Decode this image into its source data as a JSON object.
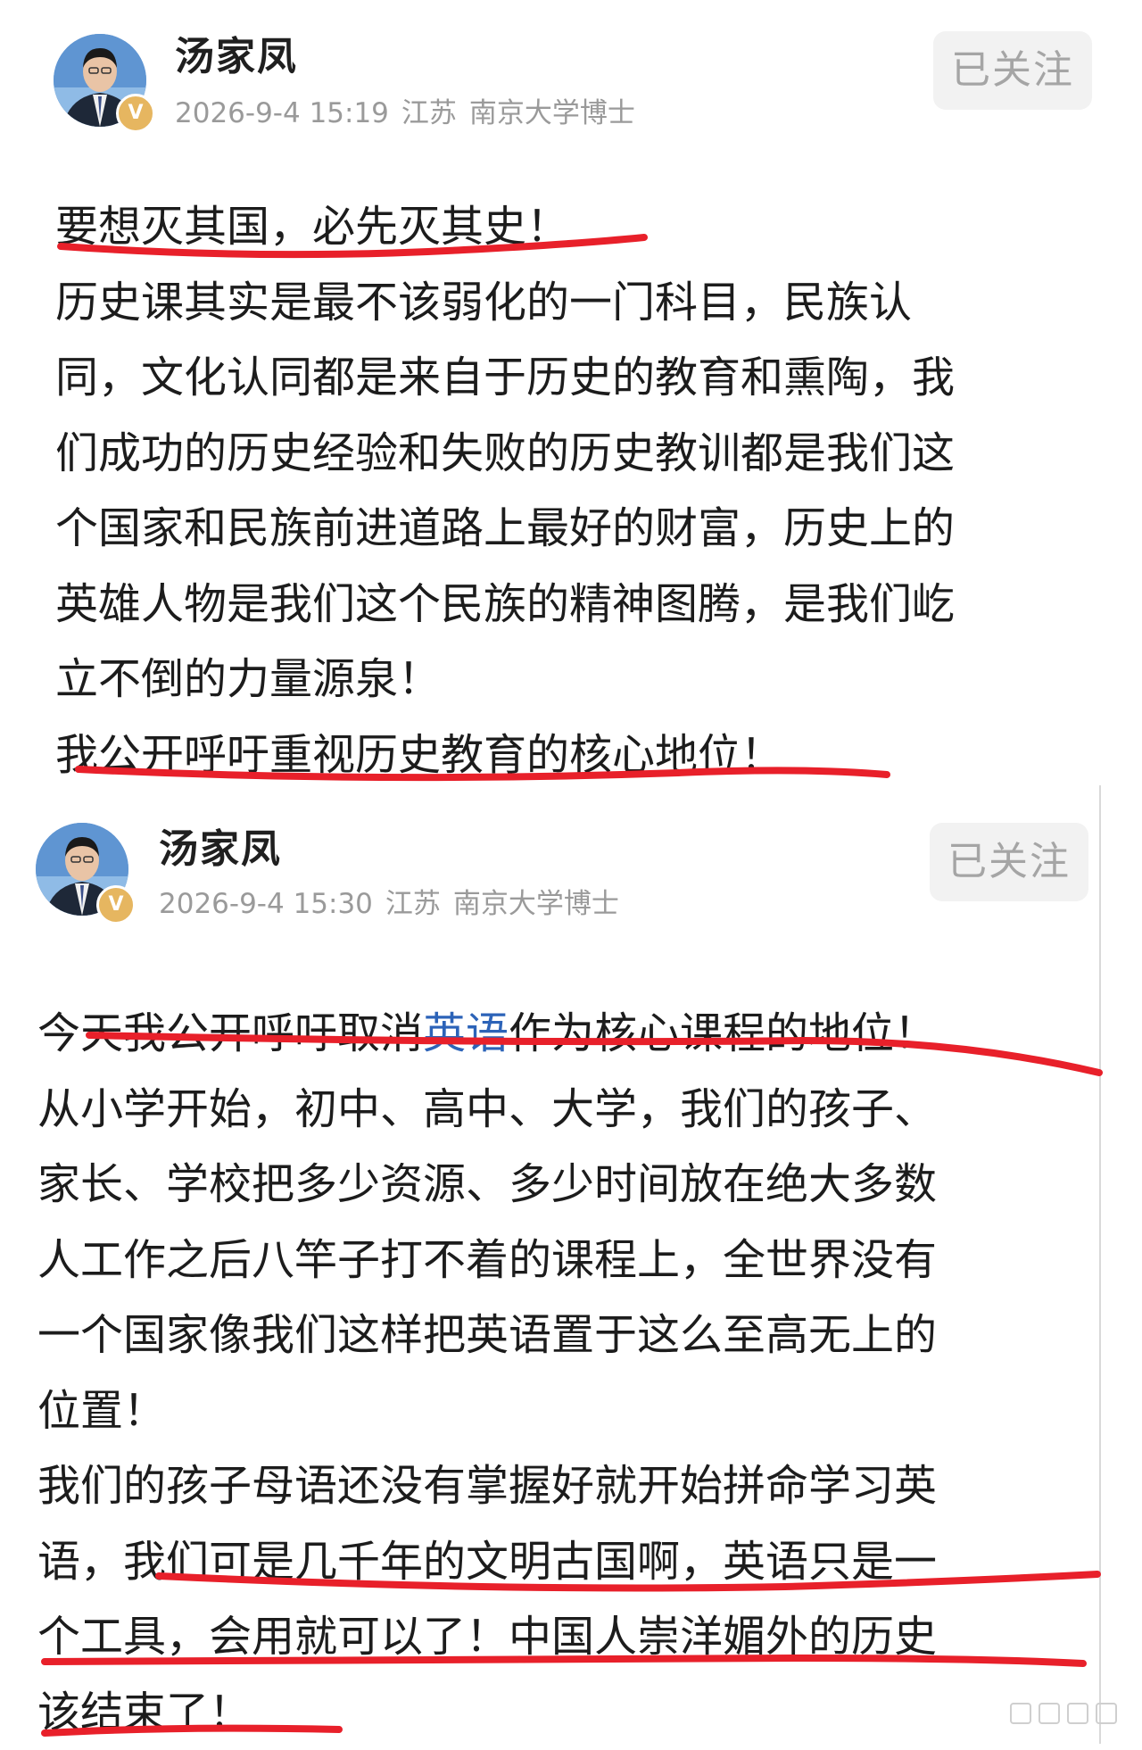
{
  "posts": [
    {
      "author": "汤家凤",
      "time": "2026-9-4 15:19",
      "location": "江苏",
      "title_info": "南京大学博士",
      "verified_badge": "V",
      "follow_label": "已关注",
      "lines": [
        "要想灭其国，必先灭其史！",
        "历史课其实是最不该弱化的一门科目，民族认",
        "同，文化认同都是来自于历史的教育和熏陶，我",
        "们成功的历史经验和失败的历史教训都是我们这",
        "个国家和民族前进道路上最好的财富，历史上的",
        "英雄人物是我们这个民族的精神图腾，是我们屹",
        "立不倒的力量源泉！",
        "我公开呼吁重视历史教育的核心地位！"
      ]
    },
    {
      "author": "汤家凤",
      "time": "2026-9-4 15:30",
      "location": "江苏",
      "title_info": "南京大学博士",
      "verified_badge": "V",
      "follow_label": "已关注",
      "line1_before": "今天我公开呼吁取消",
      "line1_tag": "英语",
      "line1_after": "作为核心课程的地位！",
      "lines": [
        "从小学开始，初中、高中、大学，我们的孩子、",
        "家长、学校把多少资源、多少时间放在绝大多数",
        "人工作之后八竿子打不着的课程上，全世界没有",
        "一个国家像我们这样把英语置于这么至高无上的",
        "位置！",
        "我们的孩子母语还没有掌握好就开始拼命学习英",
        "语，我们可是几千年的文明古国啊，英语只是一",
        "个工具，会用就可以了！中国人崇洋媚外的历史",
        "该结束了！"
      ]
    }
  ],
  "colors": {
    "underline": "#e8202a",
    "hashtag": "#2c63b8",
    "meta_text": "#9a9a9a",
    "follow_bg": "#f2f2f2"
  },
  "icons": [
    "avatar",
    "verified-badge-icon",
    "watermark-icon"
  ]
}
